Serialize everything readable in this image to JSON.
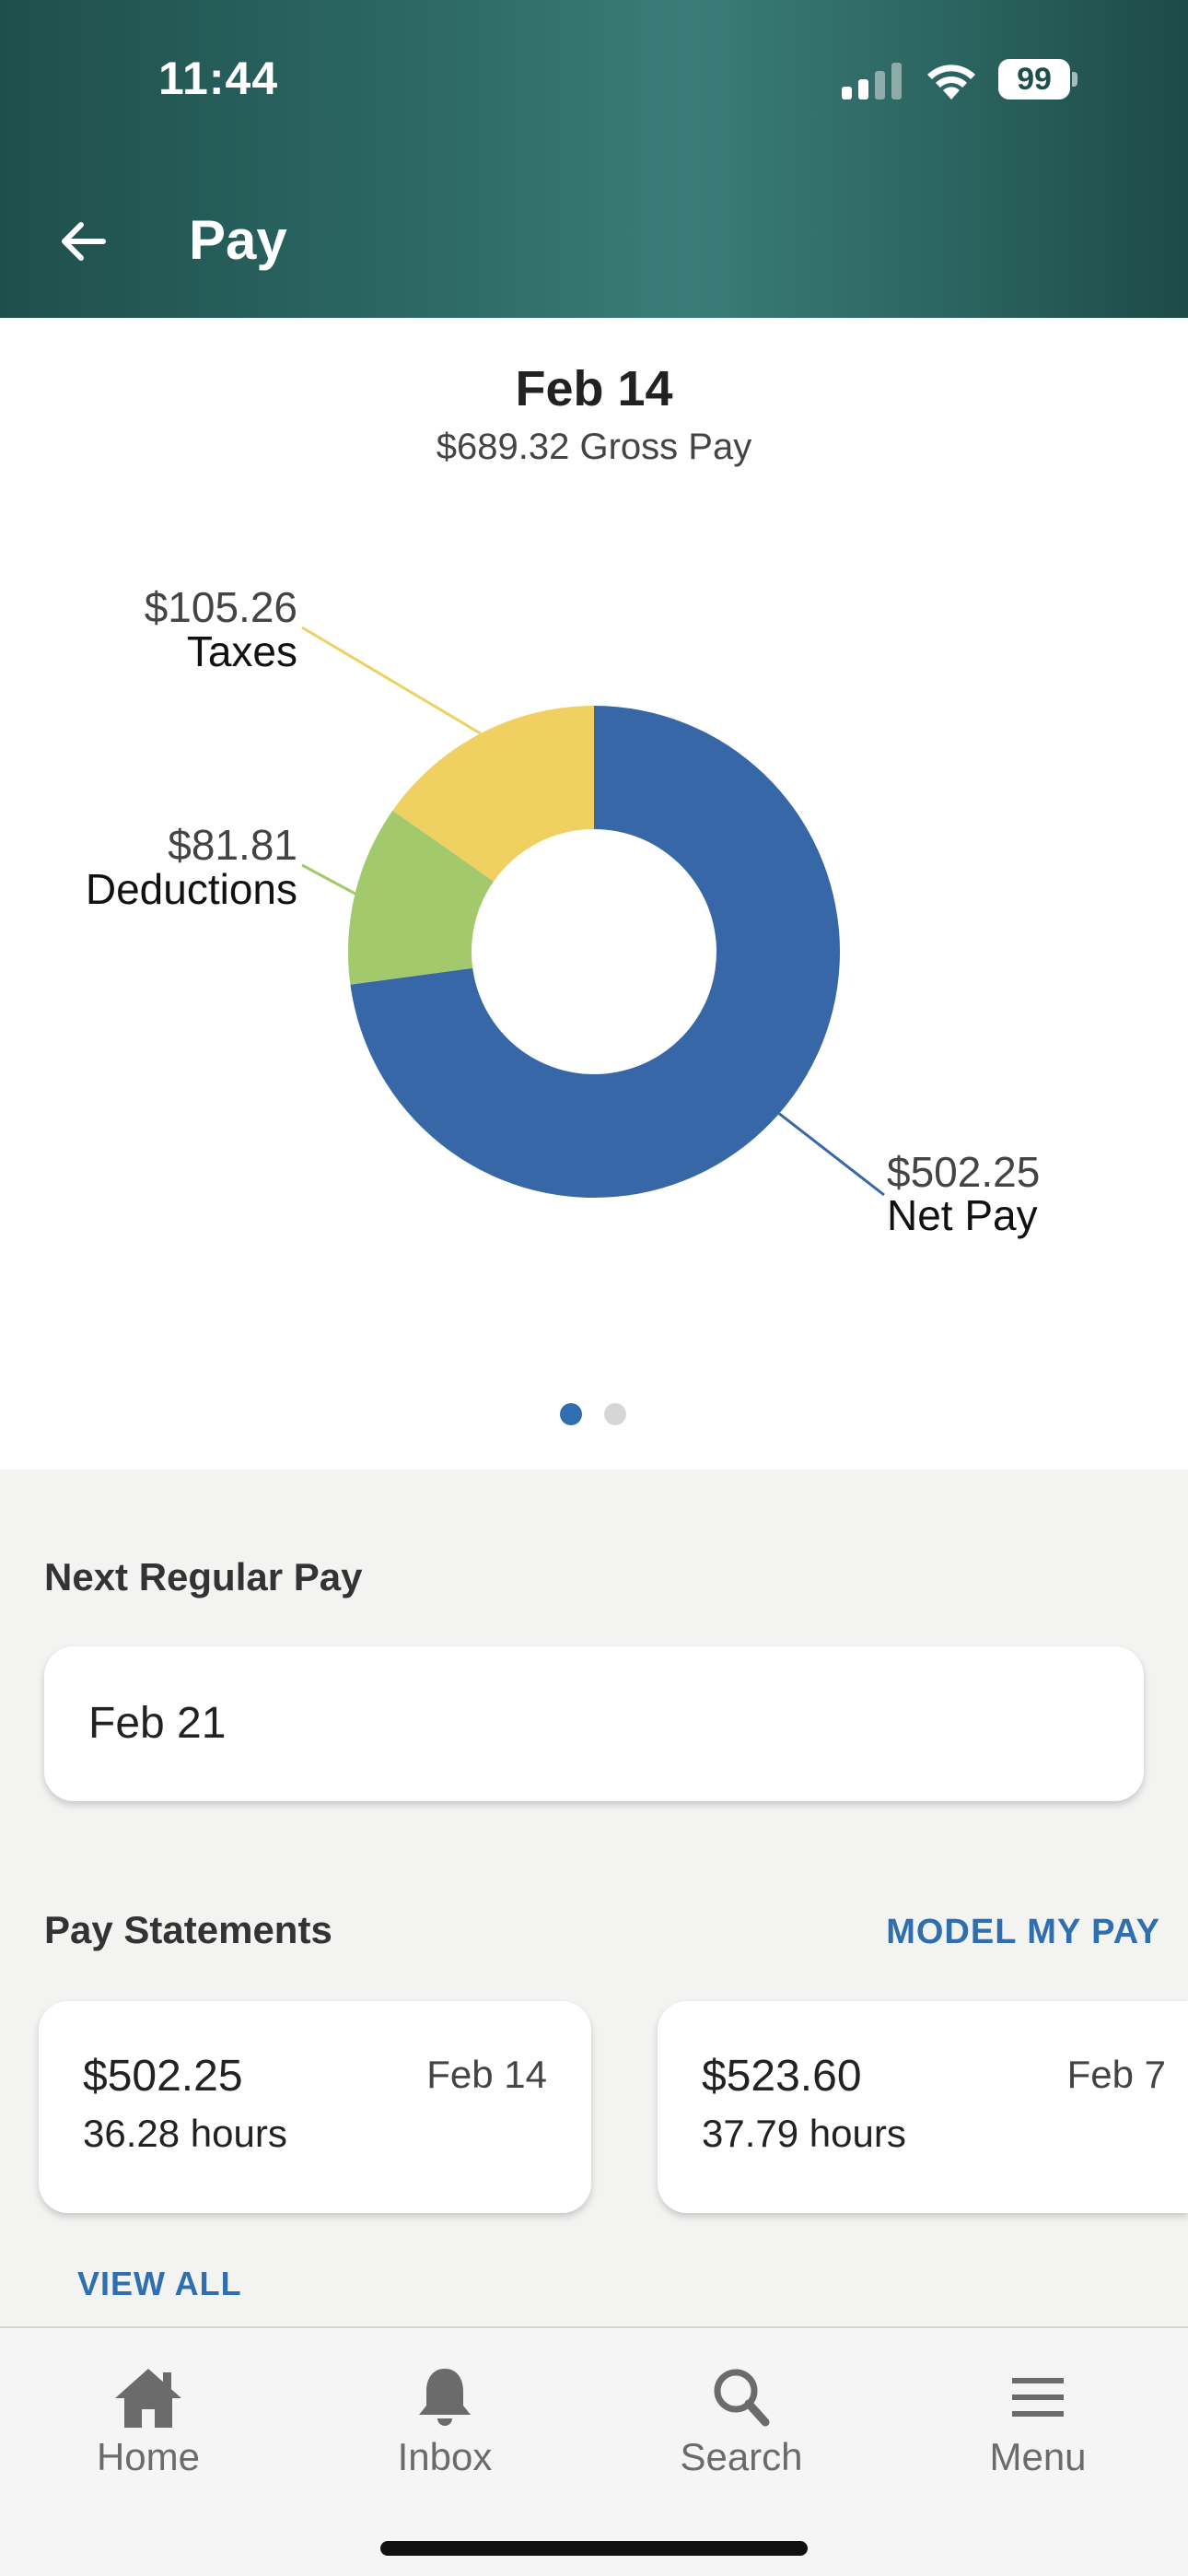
{
  "status_bar": {
    "time": "11:44",
    "battery": "99"
  },
  "header": {
    "title": "Pay",
    "back_icon": "arrow-left-icon"
  },
  "summary": {
    "date": "Feb 14",
    "gross_pay": "$689.32 Gross Pay"
  },
  "chart_data": {
    "type": "pie",
    "style": "donut",
    "slices": [
      {
        "name": "Net Pay",
        "value": 502.25,
        "label": "$502.25",
        "color": "#3867a7"
      },
      {
        "name": "Deductions",
        "value": 81.81,
        "label": "$81.81",
        "color": "#a2c96b"
      },
      {
        "name": "Taxes",
        "value": 105.26,
        "label": "$105.26",
        "color": "#efd060"
      }
    ]
  },
  "pager": {
    "current": 1,
    "total": 2
  },
  "next_regular_pay": {
    "title": "Next Regular Pay",
    "date": "Feb 21"
  },
  "pay_statements": {
    "title": "Pay Statements",
    "model_link": "MODEL MY PAY",
    "view_all": "VIEW ALL",
    "items": [
      {
        "amount": "$502.25",
        "hours": "36.28 hours",
        "date": "Feb 14"
      },
      {
        "amount": "$523.60",
        "hours": "37.79 hours",
        "date": "Feb 7"
      }
    ]
  },
  "tab_bar": {
    "items": [
      {
        "label": "Home",
        "icon": "home-icon"
      },
      {
        "label": "Inbox",
        "icon": "bell-icon"
      },
      {
        "label": "Search",
        "icon": "search-icon"
      },
      {
        "label": "Menu",
        "icon": "menu-icon"
      }
    ]
  },
  "colors": {
    "header": "#2c6864",
    "accent": "#2f6fb0"
  }
}
